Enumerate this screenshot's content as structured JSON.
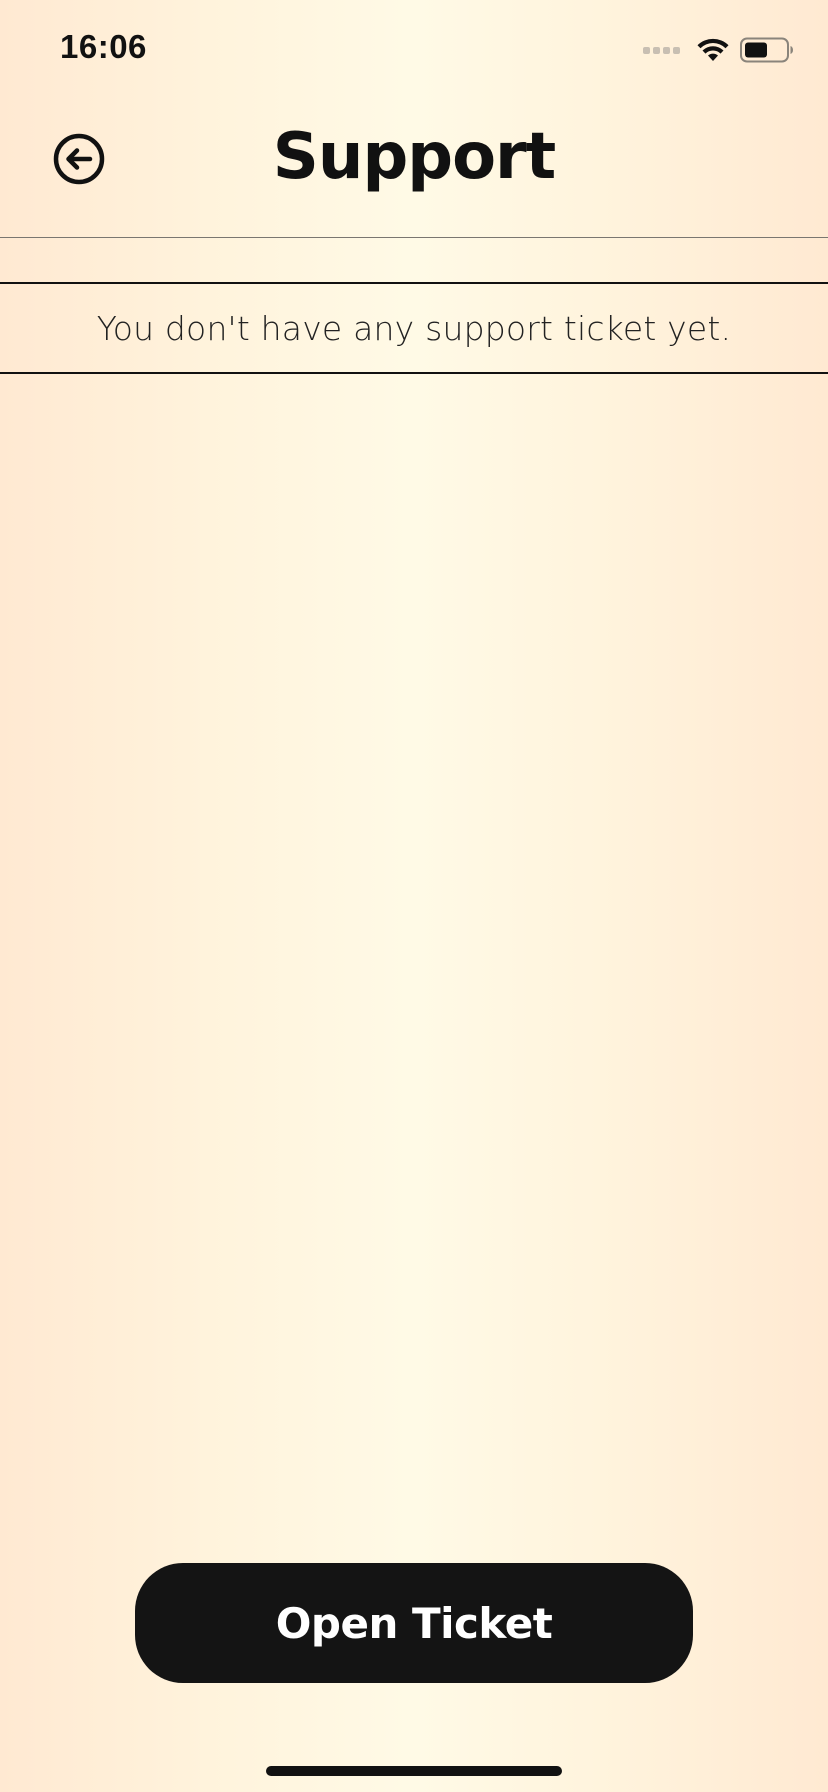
{
  "status_bar": {
    "time": "16:06",
    "icons": [
      "signal-dots-icon",
      "wifi-icon",
      "battery-icon"
    ]
  },
  "header": {
    "back_icon": "back-arrow-circle-icon",
    "title": "Support"
  },
  "tickets": {
    "empty_message": "You don't have any support ticket yet."
  },
  "actions": {
    "open_ticket_label": "Open Ticket"
  },
  "colors": {
    "background_edge": "#ffe9d2",
    "background_center": "#fffae6",
    "text_primary": "#111111",
    "button_background": "#141414",
    "button_text": "#ffffff"
  }
}
